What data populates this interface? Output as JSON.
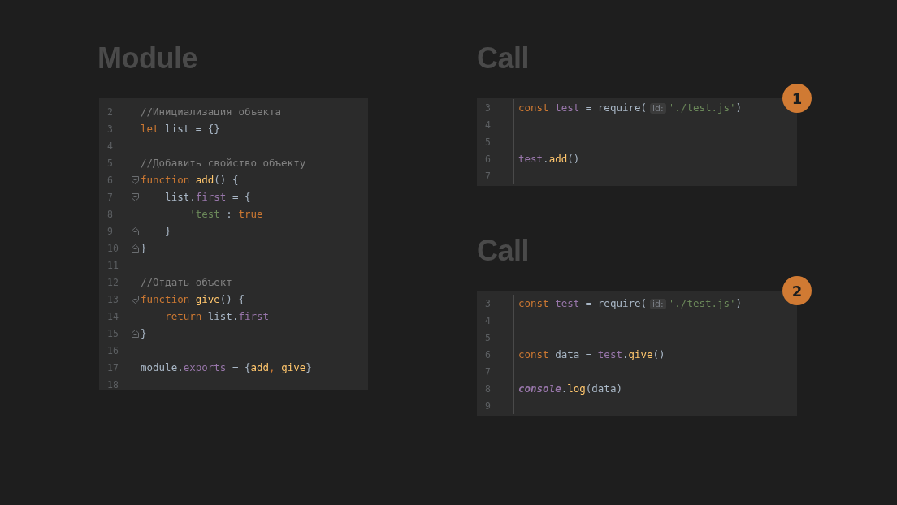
{
  "panels": [
    {
      "title": "Module",
      "lines": [
        {
          "number": "2",
          "tokens": [
            {
              "kind": "comment",
              "text": "//Инициализация объекта"
            }
          ]
        },
        {
          "number": "3",
          "tokens": [
            {
              "kind": "keyword",
              "text": "let"
            },
            {
              "kind": "plain",
              "text": " list = {}"
            }
          ]
        },
        {
          "number": "4"
        },
        {
          "number": "5",
          "tokens": [
            {
              "kind": "comment",
              "text": "//Добавить свойство объекту"
            }
          ]
        },
        {
          "number": "6",
          "fold_open": true,
          "tokens": [
            {
              "kind": "keyword",
              "text": "function "
            },
            {
              "kind": "function",
              "text": "add"
            },
            {
              "kind": "plain",
              "text": "() {"
            }
          ]
        },
        {
          "number": "7",
          "fold_open": true,
          "tokens": [
            {
              "kind": "plain",
              "text": "    list."
            },
            {
              "kind": "property",
              "text": "first"
            },
            {
              "kind": "plain",
              "text": " = {"
            }
          ]
        },
        {
          "number": "8",
          "tokens": [
            {
              "kind": "string",
              "text": "        'test'"
            },
            {
              "kind": "plain",
              "text": ": "
            },
            {
              "kind": "keyword",
              "text": "true"
            }
          ]
        },
        {
          "number": "9",
          "fold_close": true,
          "tokens": [
            {
              "kind": "plain",
              "text": "    }"
            }
          ]
        },
        {
          "number": "10",
          "fold_close": true,
          "tokens": [
            {
              "kind": "plain",
              "text": "}"
            }
          ]
        },
        {
          "number": "11"
        },
        {
          "number": "12",
          "tokens": [
            {
              "kind": "comment",
              "text": "//Отдать объект"
            }
          ]
        },
        {
          "number": "13",
          "fold_open": true,
          "tokens": [
            {
              "kind": "keyword",
              "text": "function "
            },
            {
              "kind": "function",
              "text": "give"
            },
            {
              "kind": "plain",
              "text": "() {"
            }
          ]
        },
        {
          "number": "14",
          "tokens": [
            {
              "kind": "keyword",
              "text": "    return "
            },
            {
              "kind": "plain",
              "text": "list."
            },
            {
              "kind": "property",
              "text": "first"
            }
          ]
        },
        {
          "number": "15",
          "fold_close": true,
          "tokens": [
            {
              "kind": "plain",
              "text": "}"
            }
          ]
        },
        {
          "number": "16"
        },
        {
          "number": "17",
          "tokens": [
            {
              "kind": "plain",
              "text": "module."
            },
            {
              "kind": "property",
              "text": "exports"
            },
            {
              "kind": "plain",
              "text": " = {"
            },
            {
              "kind": "function",
              "text": "add"
            },
            {
              "kind": "keyword",
              "text": ", "
            },
            {
              "kind": "function",
              "text": "give"
            },
            {
              "kind": "plain",
              "text": "}"
            }
          ]
        },
        {
          "number": "18"
        }
      ]
    },
    {
      "title": "Call",
      "badge": "1",
      "lines": [
        {
          "number": "3",
          "tokens": [
            {
              "kind": "keyword",
              "text": "const "
            },
            {
              "kind": "property",
              "text": "test"
            },
            {
              "kind": "plain",
              "text": " = require("
            },
            {
              "kind": "hint",
              "text": "id:"
            },
            {
              "kind": "string",
              "text": "'./test.js'"
            },
            {
              "kind": "plain",
              "text": ")"
            }
          ]
        },
        {
          "number": "4"
        },
        {
          "number": "5"
        },
        {
          "number": "6",
          "tokens": [
            {
              "kind": "property",
              "text": "test"
            },
            {
              "kind": "plain",
              "text": "."
            },
            {
              "kind": "function",
              "text": "add"
            },
            {
              "kind": "plain",
              "text": "()"
            }
          ]
        },
        {
          "number": "7"
        }
      ]
    },
    {
      "title": "Call",
      "badge": "2",
      "lines": [
        {
          "number": "3",
          "tokens": [
            {
              "kind": "keyword",
              "text": "const "
            },
            {
              "kind": "property",
              "text": "test"
            },
            {
              "kind": "plain",
              "text": " = require("
            },
            {
              "kind": "hint",
              "text": "id:"
            },
            {
              "kind": "string",
              "text": "'./test.js'"
            },
            {
              "kind": "plain",
              "text": ")"
            }
          ]
        },
        {
          "number": "4"
        },
        {
          "number": "5"
        },
        {
          "number": "6",
          "tokens": [
            {
              "kind": "keyword",
              "text": "const "
            },
            {
              "kind": "plain",
              "text": "data = "
            },
            {
              "kind": "property",
              "text": "test"
            },
            {
              "kind": "plain",
              "text": "."
            },
            {
              "kind": "function",
              "text": "give"
            },
            {
              "kind": "plain",
              "text": "()"
            }
          ]
        },
        {
          "number": "7"
        },
        {
          "number": "8",
          "tokens": [
            {
              "kind": "global",
              "text": "console"
            },
            {
              "kind": "plain",
              "text": "."
            },
            {
              "kind": "function",
              "text": "log"
            },
            {
              "kind": "plain",
              "text": "(data)"
            }
          ]
        },
        {
          "number": "9"
        }
      ]
    }
  ]
}
